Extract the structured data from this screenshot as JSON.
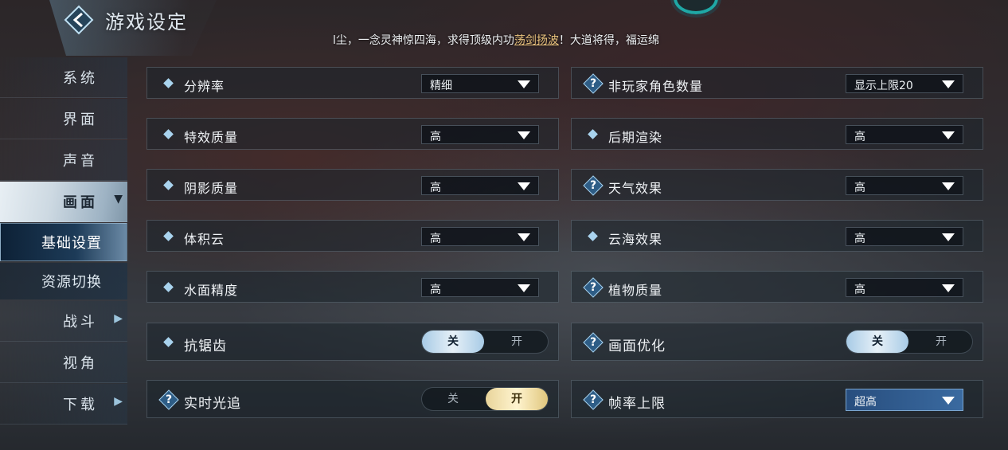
{
  "header": {
    "title": "游戏设定",
    "ticker_before": "l尘，一念灵神惊四海，求得顶级内功",
    "ticker_highlight": "荡剑扬波",
    "ticker_after": "！大道将得，福运绵"
  },
  "sidebar": {
    "items": [
      {
        "label": "系统"
      },
      {
        "label": "界面"
      },
      {
        "label": "声音"
      },
      {
        "label": "画面"
      },
      {
        "label": "基础设置"
      },
      {
        "label": "资源切换"
      },
      {
        "label": "战斗"
      },
      {
        "label": "视角"
      },
      {
        "label": "下载"
      }
    ],
    "active": "画面",
    "active_sub": "基础设置"
  },
  "settings": {
    "left": [
      {
        "name": "分辨率",
        "value": "精细"
      },
      {
        "name": "特效质量",
        "value": "高"
      },
      {
        "name": "阴影质量",
        "value": "高"
      },
      {
        "name": "体积云",
        "value": "高"
      },
      {
        "name": "水面精度",
        "value": "高"
      },
      {
        "name": "抗锯齿",
        "off": "关",
        "on": "开",
        "state": "off"
      },
      {
        "name": "实时光追",
        "off": "关",
        "on": "开",
        "state": "on"
      }
    ],
    "right": [
      {
        "name": "非玩家角色数量",
        "value": "显示上限20"
      },
      {
        "name": "后期渲染",
        "value": "高"
      },
      {
        "name": "天气效果",
        "value": "高"
      },
      {
        "name": "云海效果",
        "value": "高"
      },
      {
        "name": "植物质量",
        "value": "高"
      },
      {
        "name": "画面优化",
        "off": "关",
        "on": "开",
        "state": "off"
      },
      {
        "name": "帧率上限",
        "value": "超高"
      }
    ]
  },
  "colors": {
    "accent_blue": "#a9d3ee",
    "toggle_blue": "#a8cbe6",
    "toggle_gold": "#e8d49a",
    "highlight": "#e9c27d"
  }
}
